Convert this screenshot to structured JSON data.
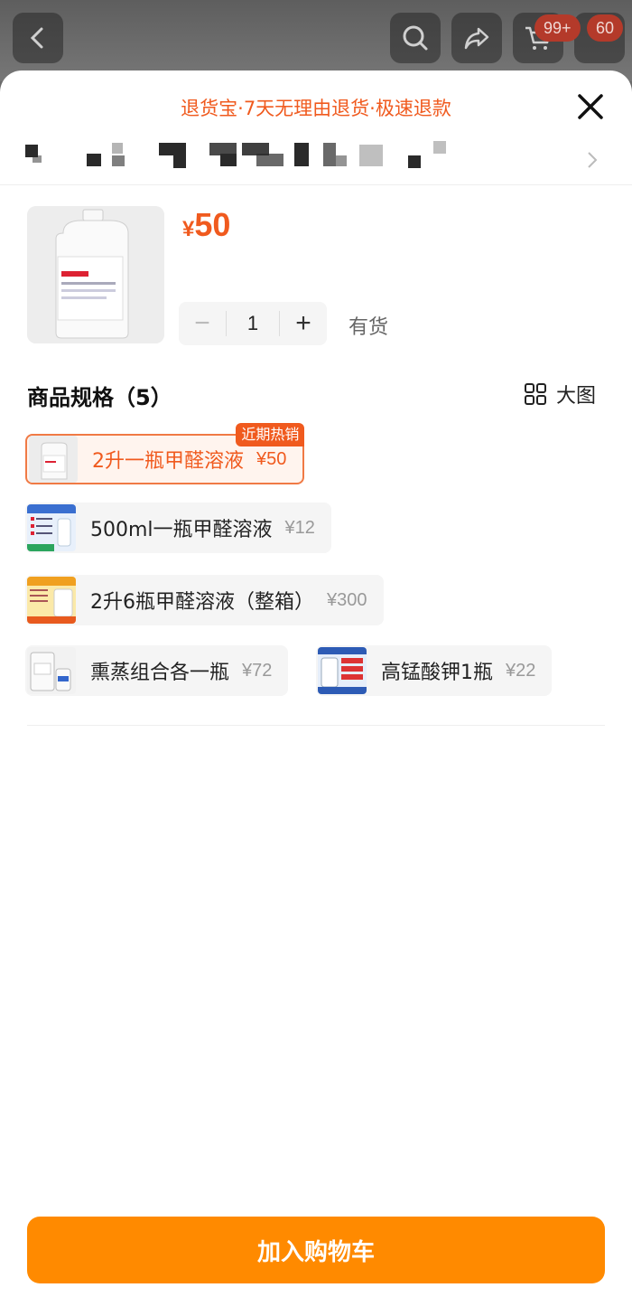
{
  "header": {
    "cart_badge": "99+",
    "msg_badge": "60"
  },
  "sheet": {
    "banner": "退货宝·7天无理由退货·极速退款"
  },
  "product": {
    "price_currency": "¥",
    "price_value": "50",
    "quantity": "1",
    "qty_minus": "−",
    "qty_plus": "+",
    "stock_status": "有货"
  },
  "specs": {
    "title": "商品规格（5）",
    "big_picture_label": "大图",
    "options": [
      {
        "name": "2升一瓶甲醛溶液",
        "price": "¥50",
        "tag": "近期热销",
        "selected": true
      },
      {
        "name": "500ml一瓶甲醛溶液",
        "price": "¥12"
      },
      {
        "name": "2升6瓶甲醛溶液（整箱）",
        "price": "¥300"
      },
      {
        "name": "熏蒸组合各一瓶",
        "price": "¥72"
      },
      {
        "name": "高锰酸钾1瓶",
        "price": "¥22"
      }
    ]
  },
  "footer": {
    "add_to_cart": "加入购物车"
  },
  "colors": {
    "accent": "#f05a1e",
    "button": "#ff8a00"
  }
}
